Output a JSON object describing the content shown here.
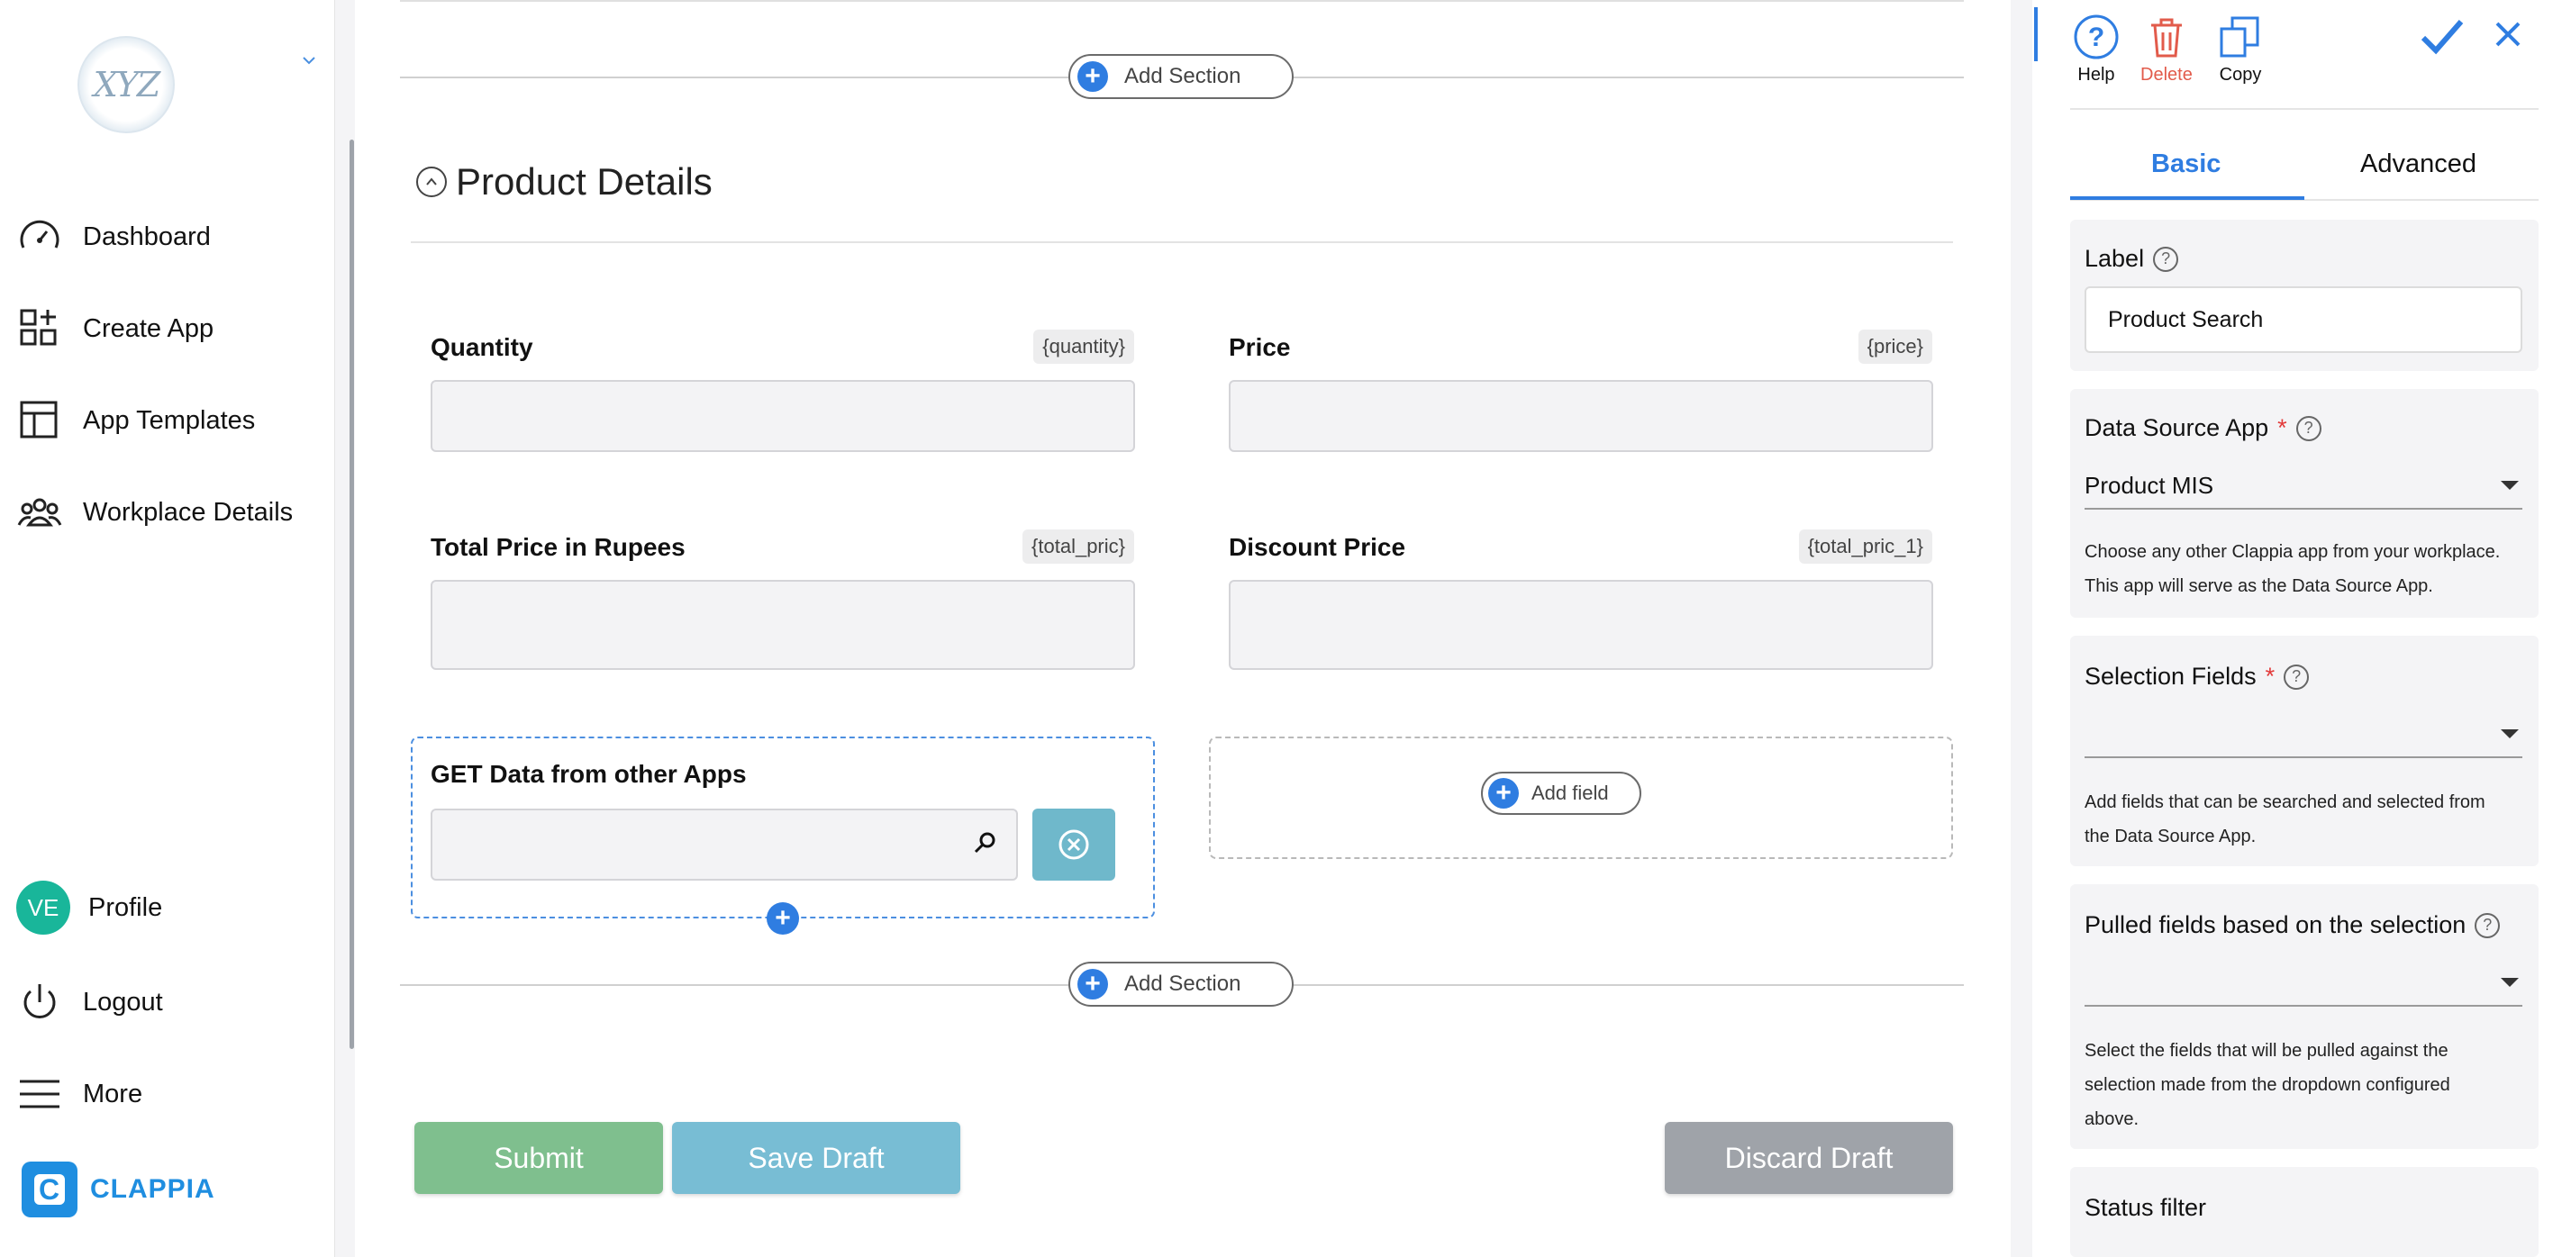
{
  "sidebar": {
    "logo_text": "XYZ",
    "nav": [
      {
        "label": "Dashboard",
        "icon": "speedometer-icon"
      },
      {
        "label": "Create App",
        "icon": "grid-plus-icon"
      },
      {
        "label": "App Templates",
        "icon": "template-icon"
      },
      {
        "label": "Workplace Details",
        "icon": "users-icon"
      }
    ],
    "profile": {
      "initials": "VE",
      "label": "Profile"
    },
    "logout": "Logout",
    "more": "More",
    "brand": {
      "mark": "C",
      "name": "CLAPPIA"
    }
  },
  "main": {
    "add_section_label": "Add Section",
    "section_title": "Product Details",
    "fields": [
      {
        "label": "Quantity",
        "var": "{quantity}"
      },
      {
        "label": "Price",
        "var": "{price}"
      },
      {
        "label": "Total Price in Rupees",
        "var": "{total_pric}"
      },
      {
        "label": "Discount Price",
        "var": "{total_pric_1}"
      }
    ],
    "get_data_label": "GET Data from other Apps",
    "add_field_label": "Add field",
    "buttons": {
      "submit": "Submit",
      "save_draft": "Save Draft",
      "discard_draft": "Discard Draft"
    }
  },
  "panel": {
    "tools": {
      "help": "Help",
      "delete": "Delete",
      "copy": "Copy"
    },
    "tabs": {
      "basic": "Basic",
      "advanced": "Advanced"
    },
    "label": {
      "title": "Label",
      "value": "Product Search"
    },
    "data_source": {
      "title": "Data Source App",
      "required": "*",
      "value": "Product MIS",
      "help_line1": "Choose any other Clappia app from your workplace.",
      "help_line2": "This app will serve as the Data Source App."
    },
    "selection_fields": {
      "title": "Selection Fields",
      "required": "*",
      "value": "",
      "help_line1": "Add fields that can be searched and selected from",
      "help_line2": "the Data Source App."
    },
    "pulled_fields": {
      "title": "Pulled fields based on the selection",
      "value": "",
      "help_line1": "Select the fields that will be pulled against the",
      "help_line2": "selection made from the dropdown configured",
      "help_line3": "above."
    },
    "status_filter": {
      "title": "Status filter"
    }
  },
  "colors": {
    "accent": "#2f7de1",
    "submit": "#7fbf8e",
    "save_draft": "#78bdd4",
    "discard": "#9fa3a9",
    "delete": "#e25b4b",
    "avatar": "#19b69a"
  }
}
